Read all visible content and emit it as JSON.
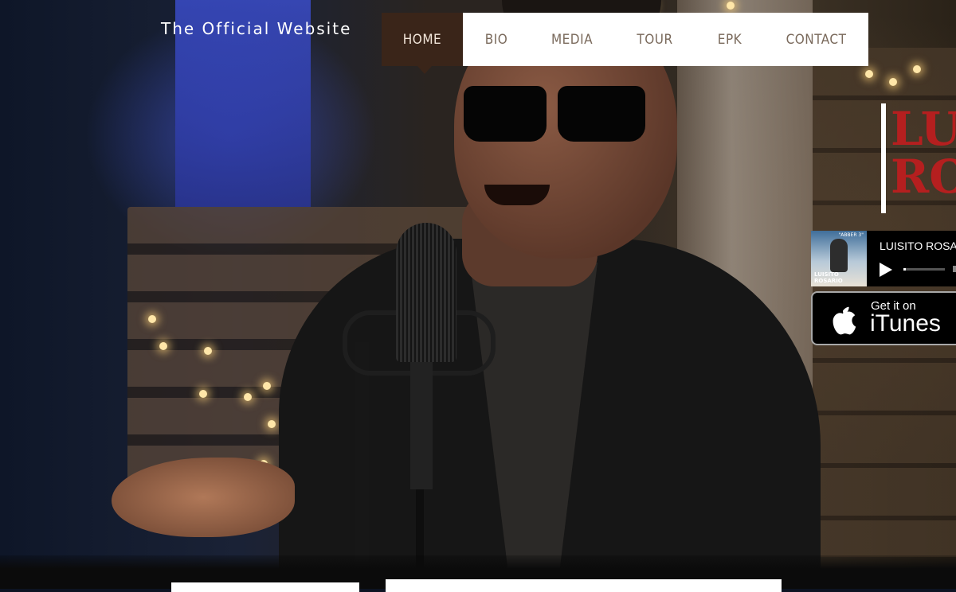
{
  "site_title": "The Official Website",
  "nav": {
    "items": [
      {
        "label": "HOME",
        "active": true
      },
      {
        "label": "BIO",
        "active": false
      },
      {
        "label": "MEDIA",
        "active": false
      },
      {
        "label": "TOUR",
        "active": false
      },
      {
        "label": "EPK",
        "active": false
      },
      {
        "label": "CONTACT",
        "active": false
      }
    ],
    "active_color": "#3a2519"
  },
  "brand": {
    "name": "LU\nRO",
    "color": "#b51f1f"
  },
  "player": {
    "track_title": "LUISITO ROSAR",
    "album_caption": "LUISITO ROSARIO",
    "album_tag": "\"ABBER 3\"",
    "progress_fraction": 0.05,
    "play_icon": "play-icon"
  },
  "itunes_badge": {
    "top_text": "Get it on",
    "main_text": "iTunes",
    "icon": "apple-icon"
  },
  "hero_image": "singer-with-microphone"
}
